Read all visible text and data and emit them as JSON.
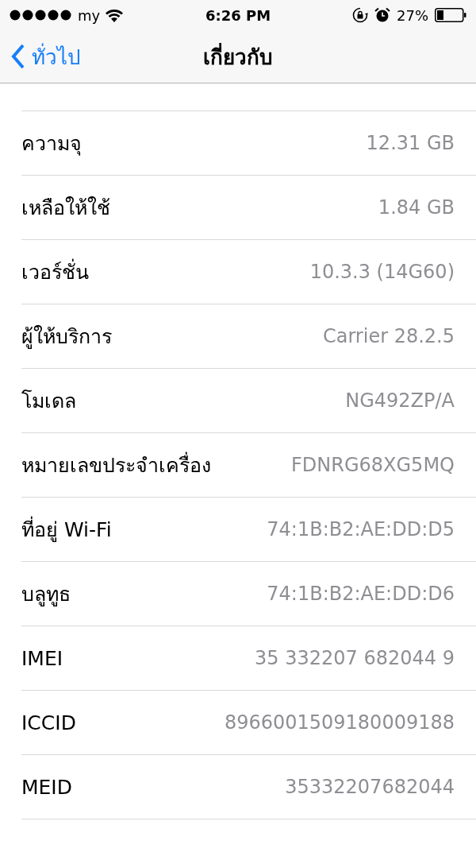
{
  "status_bar": {
    "carrier": "my",
    "time": "6:26 PM",
    "battery": "27%"
  },
  "nav_bar": {
    "back": "ทั่วไป",
    "title": "เกี่ยวกับ"
  },
  "rows": [
    {
      "label": "ความจุ",
      "value": "12.31 GB"
    },
    {
      "label": "เหลือให้ใช้",
      "value": "1.84 GB"
    },
    {
      "label": "เวอร์ชั่น",
      "value": "10.3.3 (14G60)"
    },
    {
      "label": "ผู้ให้บริการ",
      "value": "Carrier 28.2.5"
    },
    {
      "label": "โมเดล",
      "value": "NG492ZP/A"
    },
    {
      "label": "หมายเลขประจำเครื่อง",
      "value": "FDNRG68XG5MQ"
    },
    {
      "label": "ที่อยู่ Wi-Fi",
      "value": "74:1B:B2:AE:DD:D5"
    },
    {
      "label": "บลูทูธ",
      "value": "74:1B:B2:AE:DD:D6"
    },
    {
      "label": "IMEI",
      "value": "35 332207 682044 9"
    },
    {
      "label": "ICCID",
      "value": "8966001509180009188"
    },
    {
      "label": "MEID",
      "value": "35332207682044"
    }
  ]
}
